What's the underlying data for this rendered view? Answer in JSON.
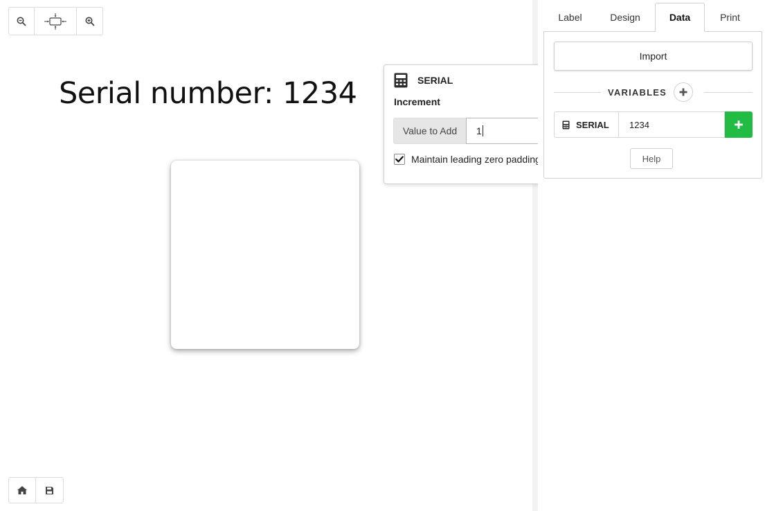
{
  "canvas": {
    "text_object": "Serial number: 1234"
  },
  "toolbar": {
    "zoom_out_icon": "zoom-out-icon",
    "fit_icon": "fit-to-view-icon",
    "zoom_in_icon": "zoom-in-icon"
  },
  "bottom_toolbar": {
    "home_icon": "home-icon",
    "save_icon": "save-icon"
  },
  "popover": {
    "icon": "calculator-icon",
    "title": "SERIAL",
    "subtitle": "Increment",
    "value_label": "Value to Add",
    "value": "1",
    "checkbox_label": "Maintain leading zero padding",
    "checkbox_checked": true
  },
  "panel": {
    "tabs": [
      {
        "label": "Label",
        "active": false
      },
      {
        "label": "Design",
        "active": false
      },
      {
        "label": "Data",
        "active": true
      },
      {
        "label": "Print",
        "active": false
      }
    ],
    "import_label": "Import",
    "variables_title": "VARIABLES",
    "variables": [
      {
        "icon": "calculator-icon",
        "name": "SERIAL",
        "value": "1234"
      }
    ],
    "help_label": "Help"
  },
  "colors": {
    "accent_green": "#22bb44",
    "tab_border": "#d0d0d0"
  }
}
